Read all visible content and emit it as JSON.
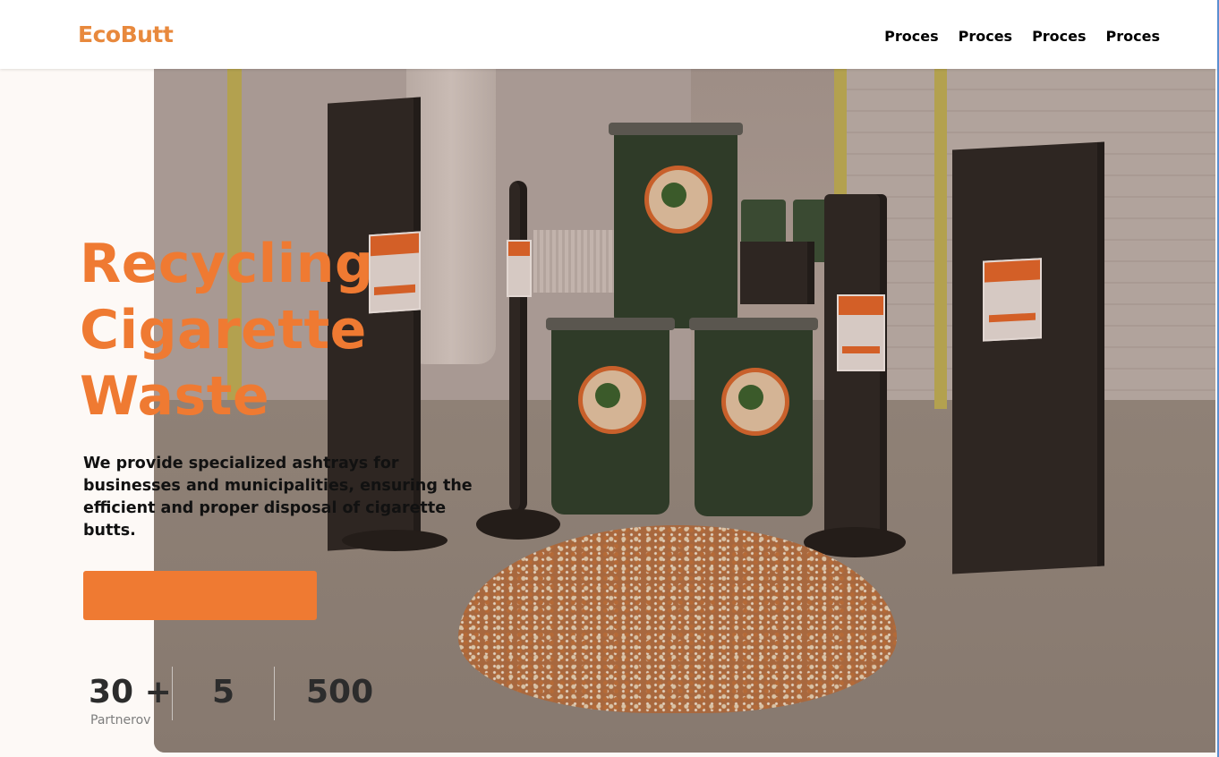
{
  "header": {
    "logo": "EcoButt",
    "nav": [
      "Proces",
      "Proces",
      "Proces",
      "Proces"
    ]
  },
  "hero": {
    "title_lines": [
      "Recycling",
      "Cigarette",
      "Waste"
    ],
    "description": "We provide specialized ashtrays for businesses and municipalities, ensuring the efficient and proper disposal of cigarette butts.",
    "cta_label": ""
  },
  "stats": [
    {
      "value": "30 +",
      "label": "Partnerov"
    },
    {
      "value": "5",
      "label": ""
    },
    {
      "value": "500",
      "label": ""
    }
  ],
  "colors": {
    "accent": "#ef7a32",
    "logo": "#e8893d",
    "text": "#111111"
  },
  "photo": {
    "icon": "hero-photo-ashtrays-and-bins"
  }
}
